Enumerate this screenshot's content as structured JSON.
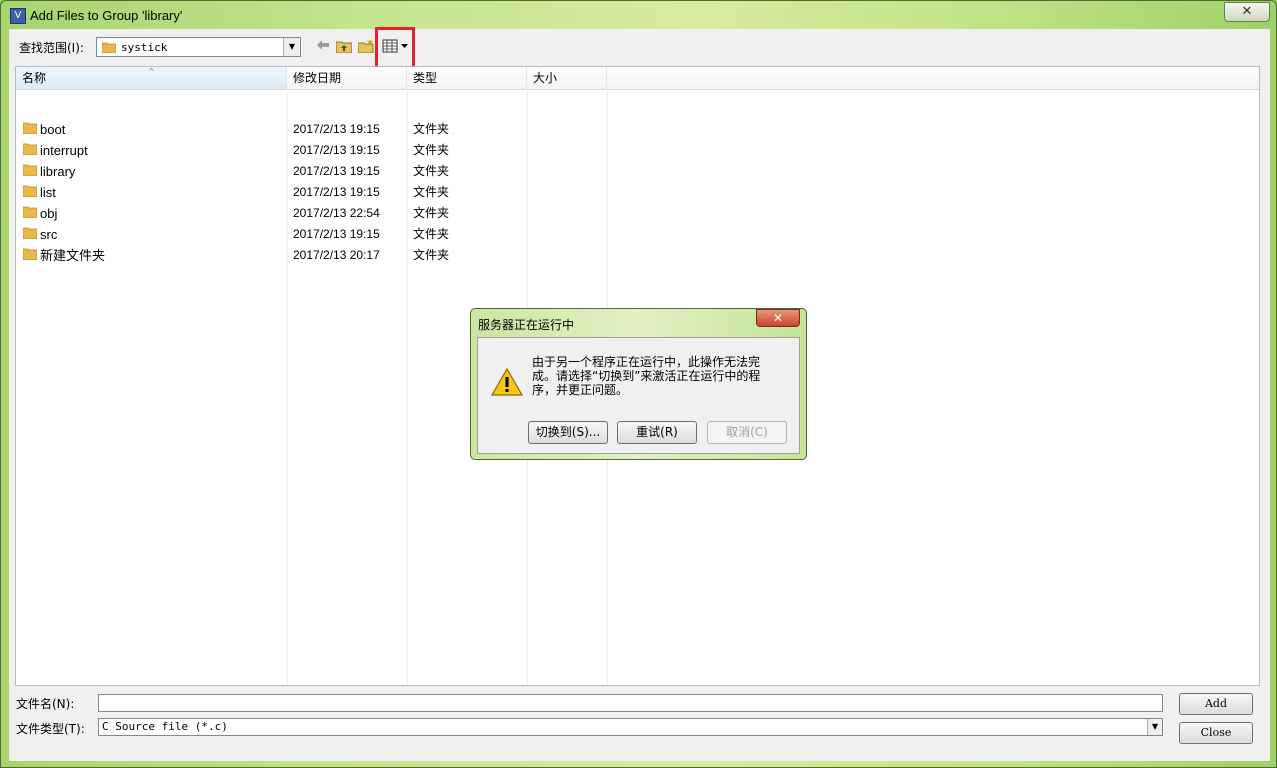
{
  "window": {
    "title": "Add Files to Group 'library'",
    "app_icon_glyph": "V",
    "close_glyph": "✕"
  },
  "toolbar": {
    "look_in_label": "查找范围(I):",
    "look_in_value": "systick",
    "icons": [
      "back-arrow-icon",
      "up-folder-icon",
      "new-folder-icon",
      "view-menu-icon"
    ]
  },
  "list": {
    "columns": [
      "名称",
      "修改日期",
      "类型",
      "大小"
    ],
    "rows": [
      {
        "name": "boot",
        "date": "2017/2/13 19:15",
        "type": "文件夹"
      },
      {
        "name": "interrupt",
        "date": "2017/2/13 19:15",
        "type": "文件夹"
      },
      {
        "name": "library",
        "date": "2017/2/13 19:15",
        "type": "文件夹"
      },
      {
        "name": "list",
        "date": "2017/2/13 19:15",
        "type": "文件夹"
      },
      {
        "name": "obj",
        "date": "2017/2/13 22:54",
        "type": "文件夹"
      },
      {
        "name": "src",
        "date": "2017/2/13 19:15",
        "type": "文件夹"
      },
      {
        "name": "新建文件夹",
        "date": "2017/2/13 20:17",
        "type": "文件夹"
      }
    ]
  },
  "bottom": {
    "filename_label": "文件名(N):",
    "filename_value": "",
    "filetype_label": "文件类型(T):",
    "filetype_value": "C Source file (*.c)",
    "add_label": "Add",
    "close_label": "Close"
  },
  "dialog": {
    "title": "服务器正在运行中",
    "message": "由于另一个程序正在运行中，此操作无法完成。请选择“切换到”来激活正在运行中的程序，并更正问题。",
    "switch_label": "切换到(S)...",
    "retry_label": "重试(R)",
    "cancel_label": "取消(C)",
    "close_glyph": "✕"
  },
  "colors": {
    "highlight": "#e0202a",
    "folder": "#e8b84a"
  }
}
